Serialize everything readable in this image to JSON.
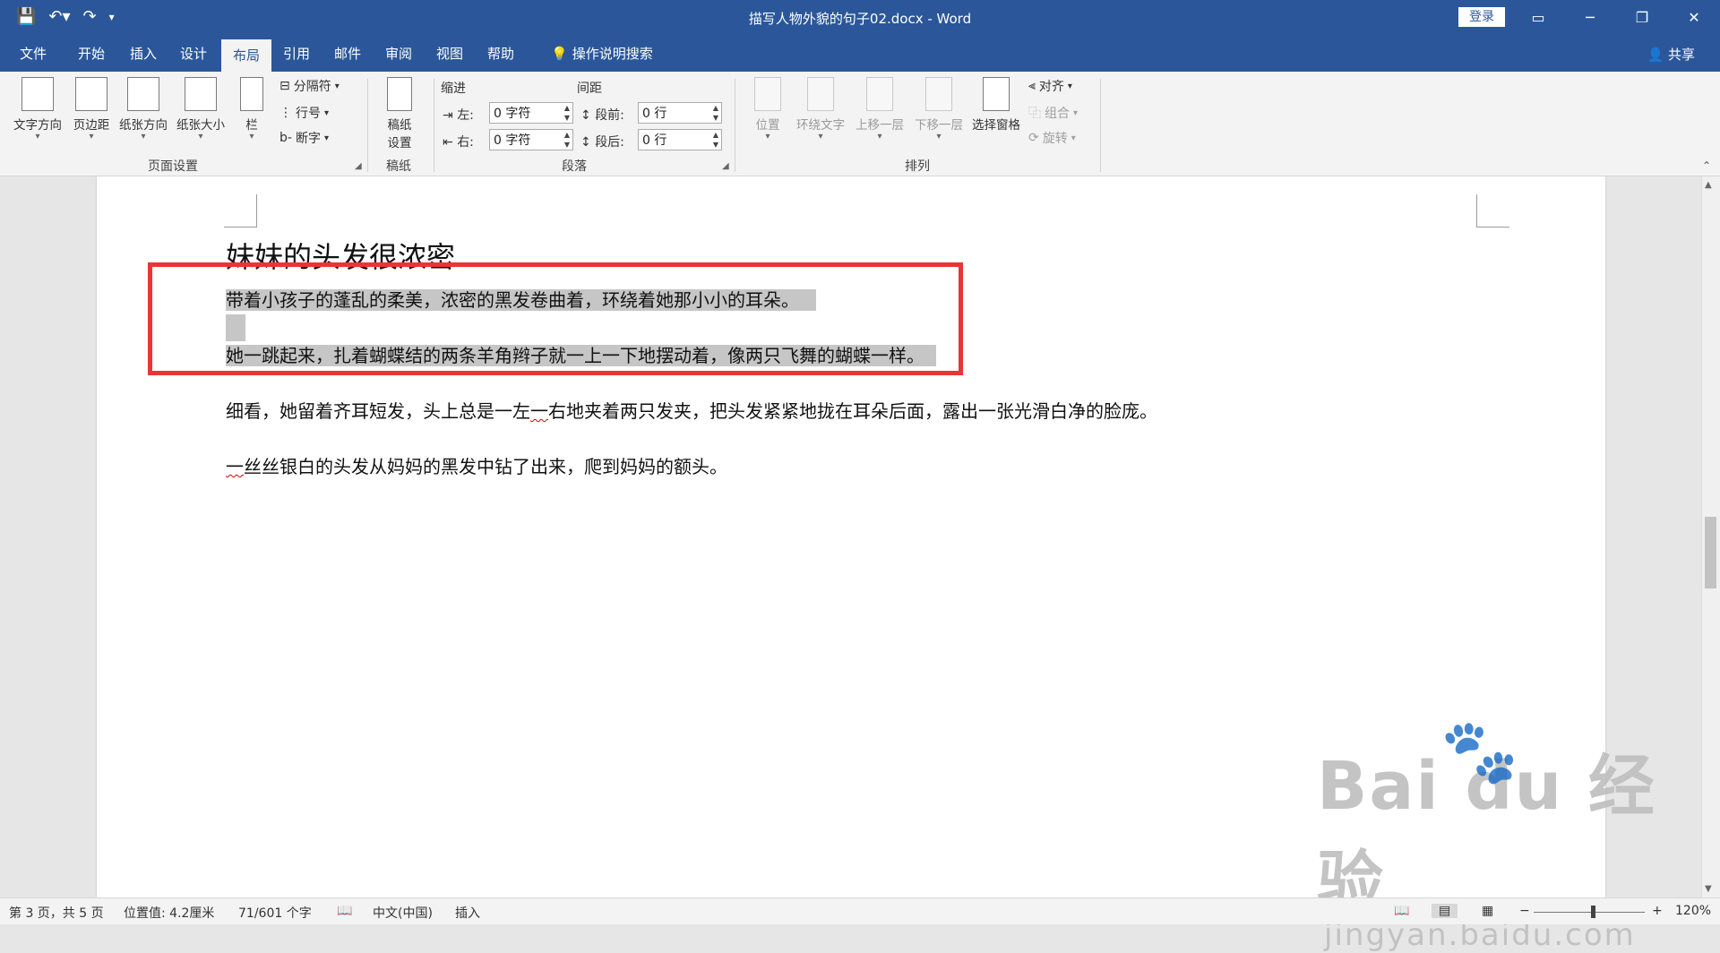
{
  "app": {
    "doc_title": "描写人物外貌的句子02.docx  -  Word",
    "login": "登录",
    "share": "共享"
  },
  "tabs": [
    "文件",
    "开始",
    "插入",
    "设计",
    "布局",
    "引用",
    "邮件",
    "审阅",
    "视图",
    "帮助"
  ],
  "active_tab": "布局",
  "tell_me": "操作说明搜索",
  "ribbon": {
    "page_setup": {
      "label": "页面设置",
      "text_direction": "文字方向",
      "margins": "页边距",
      "orientation": "纸张方向",
      "size": "纸张大小",
      "columns": "栏",
      "breaks": "分隔符",
      "line_numbers": "行号",
      "hyphenation": "断字"
    },
    "manuscript": {
      "label": "稿纸",
      "button": "稿纸",
      "button2": "设置"
    },
    "paragraph": {
      "label": "段落",
      "indent": "缩进",
      "spacing": "间距",
      "left": "左:",
      "right": "右:",
      "before": "段前:",
      "after": "段后:",
      "left_val": "0 字符",
      "right_val": "0 字符",
      "before_val": "0 行",
      "after_val": "0 行"
    },
    "arrange": {
      "label": "排列",
      "position": "位置",
      "wrap_text": "环绕文字",
      "bring_forward": "上移一层",
      "send_backward": "下移一层",
      "selection_pane": "选择窗格",
      "align": "对齐",
      "group": "组合",
      "rotate": "旋转"
    }
  },
  "document": {
    "heading": "妹妹的头发很浓密",
    "p1": "带着小孩子的蓬乱的柔美，浓密的黑发卷曲着，环绕着她那小小的耳朵。",
    "p2": "她一跳起来，扎着蝴蝶结的两条羊角辫子就一上一下地摆动着，像两只飞舞的蝴蝶一样。",
    "p3a": "细看，她留着齐耳短发，头上总是一左",
    "p3b": "一",
    "p3c": "右地夹着两只发夹，把头发紧紧地拢在耳朵后面，露出一张光滑白净的脸庞。",
    "p4a": "一",
    "p4b": "丝丝银白的头发从妈妈的黑发中钻了出来，爬到妈妈的额头。"
  },
  "watermark": {
    "main": "Bai du 经验",
    "sub": "jingyan.baidu.com"
  },
  "status": {
    "page": "第 3 页，共 5 页",
    "position": "位置值: 4.2厘米",
    "words": "71/601 个字",
    "language": "中文(中国)",
    "mode": "插入",
    "zoom": "120%",
    "zoom_level": 0.52
  }
}
